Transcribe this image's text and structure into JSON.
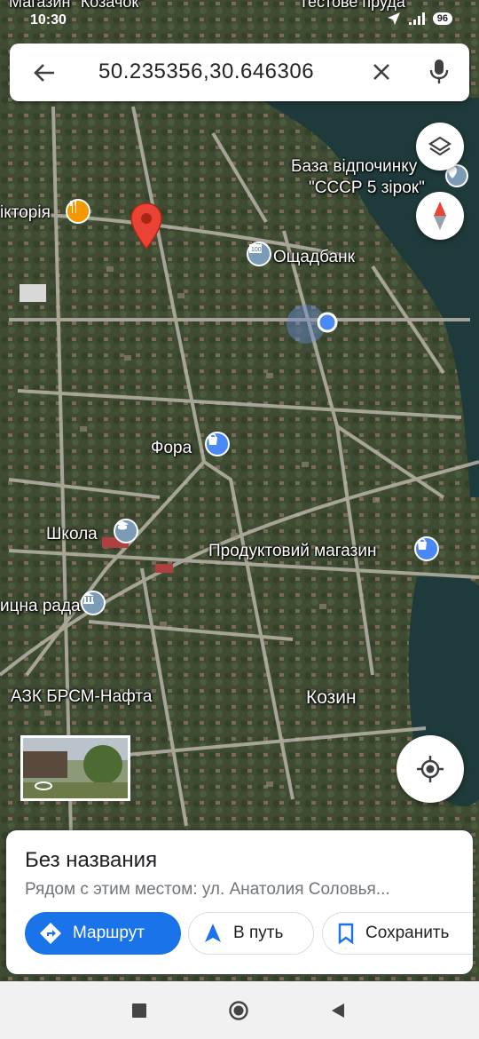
{
  "status": {
    "time": "10:30",
    "battery": "96"
  },
  "top_labels": {
    "shop_top": "Магазин \"Козачок\"",
    "pond_top": "Тестове пруда"
  },
  "search": {
    "query": "50.235356,30.646306"
  },
  "map_labels": {
    "base": "База відпочинку\n\"СССР 5 зірок\"",
    "base_line1": "База відпочинку",
    "base_line2": "\"СССР 5 зірок\"",
    "viktoria": "ікторія",
    "oschadbank": "Ощадбанк",
    "fora": "Фора",
    "school": "Школа",
    "product_shop": "Продуктовий магазин",
    "council": "ицна рада",
    "gas": "АЗК БРСМ-Нафта",
    "kozyn": "Козин"
  },
  "colors": {
    "accent": "#1a73e8",
    "pin": "#ea4335",
    "poi_blue": "#4a89f3",
    "poi_orange": "#f29900",
    "poi_gray": "#7b9bb6"
  },
  "place": {
    "title": "Без названия",
    "subtitle": "Рядом с этим местом: ул. Анатолия Соловья..."
  },
  "actions": {
    "route": "Маршрут",
    "go": "В путь",
    "save": "Сохранить"
  },
  "icons": [
    "back-arrow-icon",
    "close-icon",
    "mic-icon",
    "layers-icon",
    "compass-icon",
    "my-location-icon",
    "directions-icon",
    "navigation-icon",
    "bookmark-icon"
  ]
}
